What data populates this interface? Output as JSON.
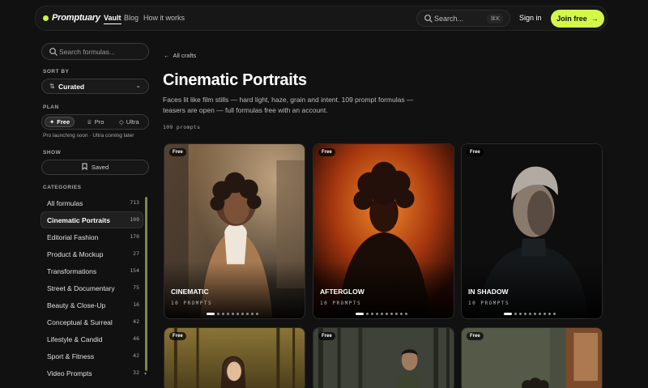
{
  "nav": {
    "logo": "Promptuary",
    "links": [
      "Vault",
      "Blog",
      "How it works"
    ],
    "search_label": "Search...",
    "search_kbd": "⌘K",
    "signin": "Sign in",
    "join": "Join free"
  },
  "sidebar": {
    "search_placeholder": "Search formulas...",
    "sort_label": "SORT BY",
    "sort_value": "Curated",
    "plan_label": "PLAN",
    "plans": [
      "Free",
      "Pro",
      "Ultra"
    ],
    "plan_note": "Pro launching soon · Ultra coming later",
    "show_label": "SHOW",
    "saved": "Saved",
    "categories_label": "CATEGORIES",
    "categories": [
      {
        "name": "All formulas",
        "count": "713"
      },
      {
        "name": "Cinematic Portraits",
        "count": "109"
      },
      {
        "name": "Editorial Fashion",
        "count": "170"
      },
      {
        "name": "Product & Mockup",
        "count": "27"
      },
      {
        "name": "Transformations",
        "count": "154"
      },
      {
        "name": "Street & Documentary",
        "count": "75"
      },
      {
        "name": "Beauty & Close-Up",
        "count": "16"
      },
      {
        "name": "Conceptual & Surreal",
        "count": "42"
      },
      {
        "name": "Lifestyle & Candid",
        "count": "46"
      },
      {
        "name": "Sport & Fitness",
        "count": "42"
      },
      {
        "name": "Video Prompts",
        "count": "32"
      }
    ]
  },
  "main": {
    "back": "All crafts",
    "title": "Cinematic Portraits",
    "description": "Faces lit like film stills — hard light, haze, grain and intent. 109 prompt formulas — teasers are open — full formulas free with an account.",
    "count": "109 prompts",
    "cards": [
      {
        "badge": "Free",
        "title": "CINEMATIC",
        "sub": "10 PROMPTS"
      },
      {
        "badge": "Free",
        "title": "AFTERGLOW",
        "sub": "10 PROMPTS"
      },
      {
        "badge": "Free",
        "title": "IN SHADOW",
        "sub": "10 PROMPTS"
      },
      {
        "badge": "Free"
      },
      {
        "badge": "Free"
      },
      {
        "badge": "Free"
      }
    ]
  },
  "colors": {
    "accent": "#d4f84a",
    "background": "#111111"
  }
}
